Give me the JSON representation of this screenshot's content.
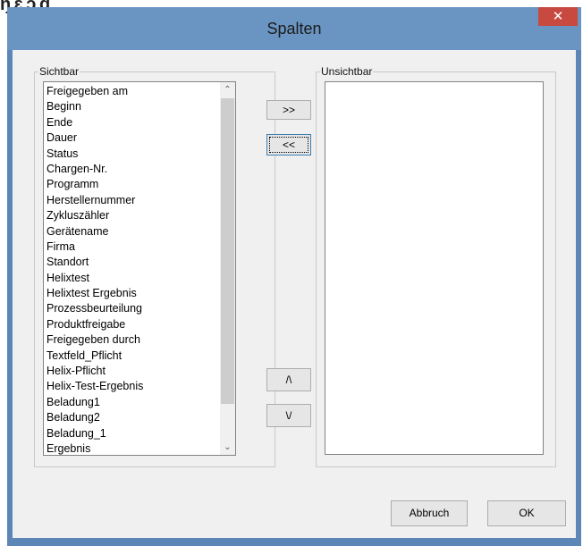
{
  "window": {
    "title": "Spalten",
    "close_glyph": "✕"
  },
  "visible_group": {
    "label": "Sichtbar",
    "items": [
      "Freigegeben am",
      "Beginn",
      "Ende",
      "Dauer",
      "Status",
      "Chargen-Nr.",
      "Programm",
      "Herstellernummer",
      "Zykluszähler",
      "Gerätename",
      "Firma",
      "Standort",
      "Helixtest",
      "Helixtest Ergebnis",
      "Prozessbeurteilung",
      "Produktfreigabe",
      "Freigegeben durch",
      "Textfeld_Pflicht",
      "Helix-Pflicht",
      "Helix-Test-Ergebnis",
      "Beladung1",
      "Beladung2",
      "Beladung_1",
      "Ergebnis"
    ],
    "scroll_up_glyph": "⌃",
    "scroll_down_glyph": "⌄"
  },
  "hidden_group": {
    "label": "Unsichtbar",
    "items": []
  },
  "buttons": {
    "move_right": ">>",
    "move_left": "<<",
    "move_up": "/\\",
    "move_down": "\\/",
    "cancel": "Abbruch",
    "ok": "OK"
  },
  "colors": {
    "titlebar": "#6a95c3",
    "close_button": "#c7493f",
    "dialog_bg": "#f0f0f0"
  }
}
